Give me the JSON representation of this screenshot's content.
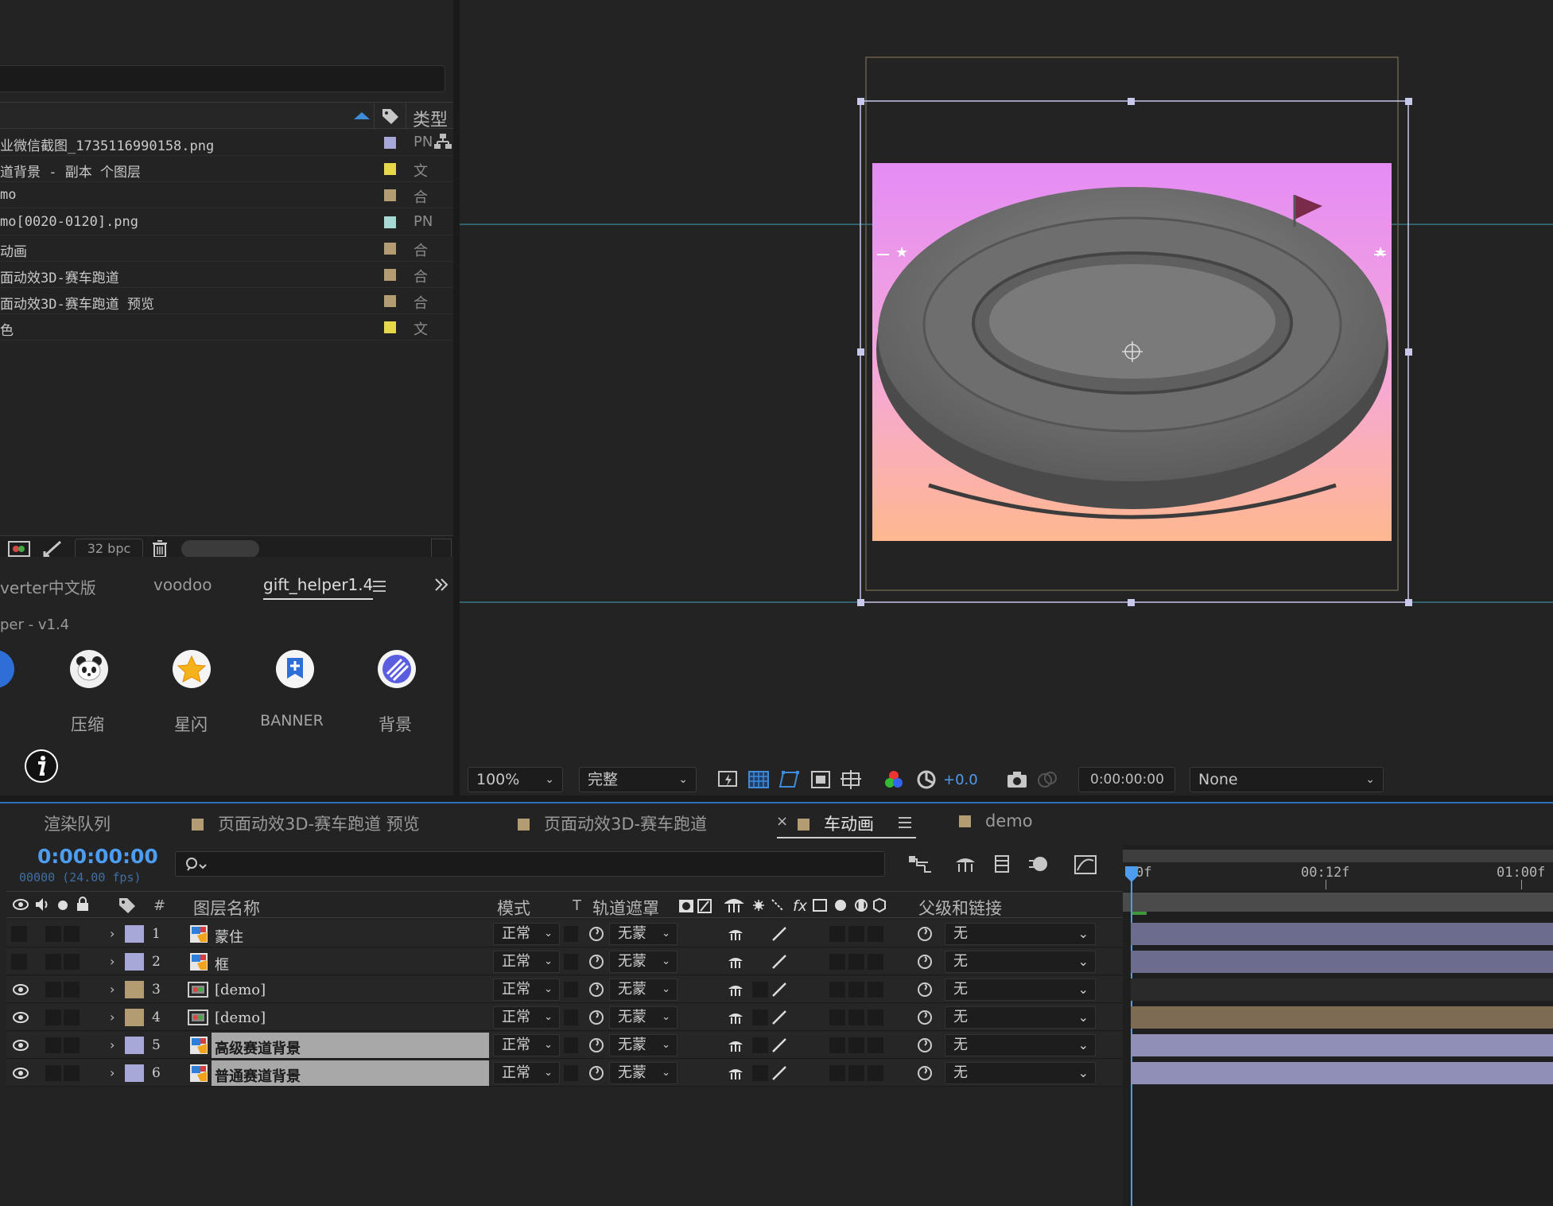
{
  "project": {
    "columns": {
      "type": "类型"
    },
    "items": [
      {
        "name": "业微信截图_1735116990158.png",
        "color": "#a8a8d8",
        "type": "PN"
      },
      {
        "name": "道背景 - 副本 个图层",
        "color": "#e7d84a",
        "type": "文"
      },
      {
        "name": "mo",
        "color": "#b39b72",
        "type": "合"
      },
      {
        "name": "mo[0020-0120].png",
        "color": "#a6d9d4",
        "type": "PN"
      },
      {
        "name": "动画",
        "color": "#b39b72",
        "type": "合"
      },
      {
        "name": "面动效3D-赛车跑道",
        "color": "#b39b72",
        "type": "合"
      },
      {
        "name": "面动效3D-赛车跑道 预览",
        "color": "#b39b72",
        "type": "合"
      },
      {
        "name": "色",
        "color": "#e7d84a",
        "type": "文"
      }
    ],
    "footer": {
      "bpc": "32 bpc"
    }
  },
  "extension": {
    "tabs": [
      {
        "label": "verter中文版"
      },
      {
        "label": "voodoo"
      },
      {
        "label": "gift_helper1.4"
      }
    ],
    "title": "per - v1.4",
    "buttons": [
      {
        "label": "压缩",
        "icon": "panda-icon"
      },
      {
        "label": "星闪",
        "icon": "star-icon"
      },
      {
        "label": "BANNER",
        "icon": "banner-icon"
      },
      {
        "label": "背景",
        "icon": "stripes-icon"
      }
    ]
  },
  "viewer": {
    "zoom": "100%",
    "resolution": "完整",
    "exposure": "+0.0",
    "timecode": "0:00:00:00",
    "view_select": "None"
  },
  "timeline": {
    "tabs": [
      {
        "label": "渲染队列",
        "color": ""
      },
      {
        "label": "页面动效3D-赛车跑道 预览",
        "color": "#b39b72"
      },
      {
        "label": "页面动效3D-赛车跑道",
        "color": "#b39b72"
      },
      {
        "label": "车动画",
        "color": "#b39b72"
      },
      {
        "label": "demo",
        "color": "#b39b72"
      }
    ],
    "timecode": "0:00:00:00",
    "frames": "00000 (24.00 fps)",
    "columns": {
      "num": "#",
      "name": "图层名称",
      "mode": "模式",
      "t": "T",
      "matte": "轨道遮罩",
      "parent": "父级和链接"
    },
    "ruler": [
      "0f",
      "00:12f",
      "01:00f"
    ],
    "layers": [
      {
        "num": "1",
        "name": "蒙住",
        "color": "#a8a8d8",
        "mode": "正常",
        "matte": "无蒙",
        "parent": "无",
        "eye": false,
        "selected": false,
        "bar_color": "#6c6c8e"
      },
      {
        "num": "2",
        "name": "框",
        "color": "#a8a8d8",
        "mode": "正常",
        "matte": "无蒙",
        "parent": "无",
        "eye": false,
        "selected": false,
        "bar_color": "#6c6c8e"
      },
      {
        "num": "3",
        "name": "[demo]",
        "color": "#b39b72",
        "mode": "正常",
        "matte": "无蒙",
        "parent": "无",
        "eye": true,
        "selected": false,
        "bar_color": "#2a2a2a"
      },
      {
        "num": "4",
        "name": "[demo]",
        "color": "#b39b72",
        "mode": "正常",
        "matte": "无蒙",
        "parent": "无",
        "eye": true,
        "selected": false,
        "bar_color": "#7d6b54"
      },
      {
        "num": "5",
        "name": "高级赛道背景",
        "color": "#a8a8d8",
        "mode": "正常",
        "matte": "无蒙",
        "parent": "无",
        "eye": true,
        "selected": true,
        "bar_color": "#8f8fb8"
      },
      {
        "num": "6",
        "name": "普通赛道背景",
        "color": "#a8a8d8",
        "mode": "正常",
        "matte": "无蒙",
        "parent": "无",
        "eye": true,
        "selected": true,
        "bar_color": "#8f8fb8"
      }
    ]
  },
  "colors": {
    "accent": "#4e9cf0",
    "bg": "#232323"
  }
}
